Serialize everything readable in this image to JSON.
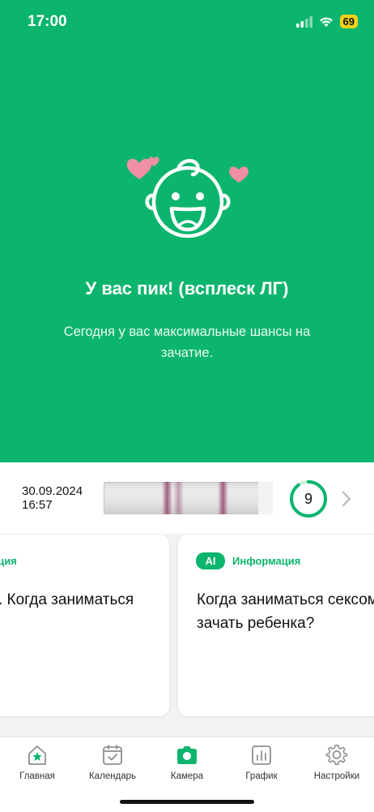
{
  "status_bar": {
    "time": "17:00",
    "battery": "69",
    "signal_icon": "cellular-signal-icon",
    "wifi_icon": "wifi-icon"
  },
  "hero": {
    "illustration": "baby-face-with-hearts",
    "title": "У вас пик! (всплеск ЛГ)",
    "description": "Сегодня у вас максимальные шансы на зачатие."
  },
  "test_result": {
    "date": "30.09.2024",
    "time": "16:57",
    "score": "9",
    "score_fraction": 0.9
  },
  "cards": [
    {
      "tag": "ация",
      "body_lines": [
        "Г. Когда заниматься"
      ]
    },
    {
      "badge": "AI",
      "tag": "Информация",
      "body_lines": [
        "Когда заниматься сексом",
        "зачать ребенка?"
      ]
    }
  ],
  "tabbar": {
    "items": [
      {
        "label": "Главная",
        "icon": "home-star-icon"
      },
      {
        "label": "Календарь",
        "icon": "calendar-icon"
      },
      {
        "label": "Камера",
        "icon": "camera-icon"
      },
      {
        "label": "График",
        "icon": "chart-icon"
      },
      {
        "label": "Настройки",
        "icon": "gear-icon"
      }
    ]
  },
  "colors": {
    "accent": "#0cb56d",
    "heart": "#f08fa6"
  }
}
